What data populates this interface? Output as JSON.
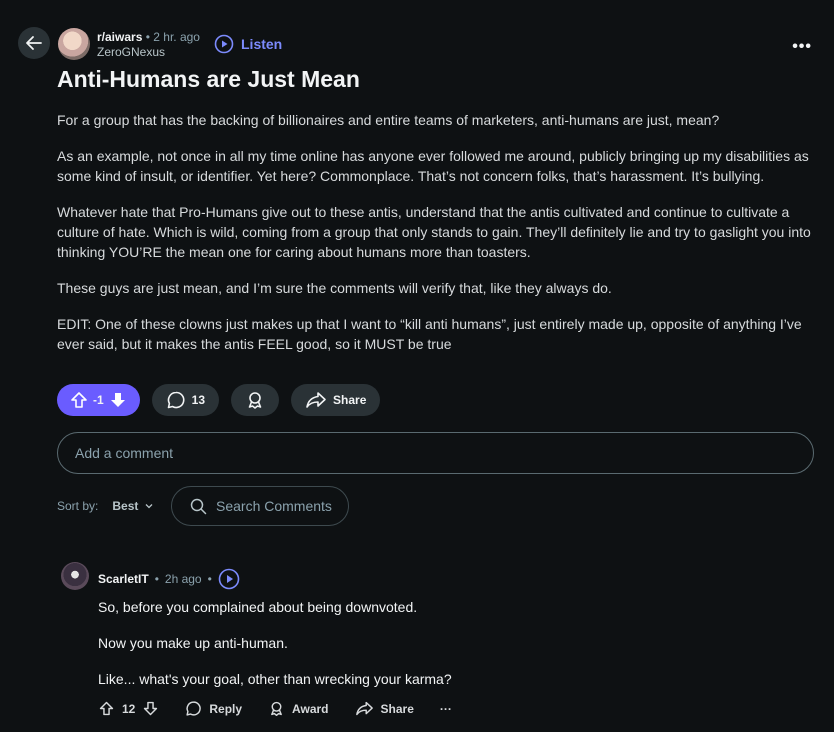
{
  "post": {
    "subreddit": "r/aiwars",
    "separator": "•",
    "time": "2 hr. ago",
    "author": "ZeroGNexus",
    "listen_label": "Listen",
    "title": "Anti-Humans are Just Mean",
    "paragraphs": [
      "For a group that has the backing of billionaires and entire teams of marketers, anti-humans are just, mean?",
      "As an example, not once in all my time online has anyone ever followed me around, publicly bringing up my disabilities as some kind of insult, or identifier. Yet here? Commonplace. That’s not concern folks, that’s harassment. It’s bullying.",
      "Whatever hate that Pro-Humans give out to these antis, understand that the antis cultivated and continue to cultivate a culture of hate. Which is wild, coming from a group that only stands to gain. They’ll definitely lie and try to gaslight you into thinking YOU’RE the mean one for caring about humans more than toasters.",
      "These guys are just mean, and I’m sure the comments will verify that, like they always do.",
      "EDIT: One of these clowns just makes up that I want to “kill anti humans”, just entirely made up, opposite of anything I’ve ever said, but it makes the antis FEEL good, so it MUST be true"
    ],
    "vote_count": "-1",
    "comment_count": "13",
    "share_label": "Share",
    "accent": "#6a5cff"
  },
  "comment_box": {
    "placeholder": "Add a comment"
  },
  "sort": {
    "label": "Sort by:",
    "value": "Best"
  },
  "search": {
    "placeholder": "Search Comments"
  },
  "comment": {
    "author": "ScarletIT",
    "separator": "•",
    "time": "2h ago",
    "separator2": "•",
    "lines": [
      "So, before you complained about being downvoted.",
      "Now you make up anti-human.",
      "Like... what's your goal, other than wrecking your karma?"
    ],
    "score": "12",
    "reply_label": "Reply",
    "award_label": "Award",
    "share_label": "Share",
    "more_label": "···"
  },
  "icons": [
    "back-arrow-icon",
    "play-icon",
    "more-icon",
    "upvote-icon",
    "downvote-icon",
    "comment-icon",
    "award-icon",
    "share-icon",
    "search-icon",
    "chevron-down-icon"
  ]
}
